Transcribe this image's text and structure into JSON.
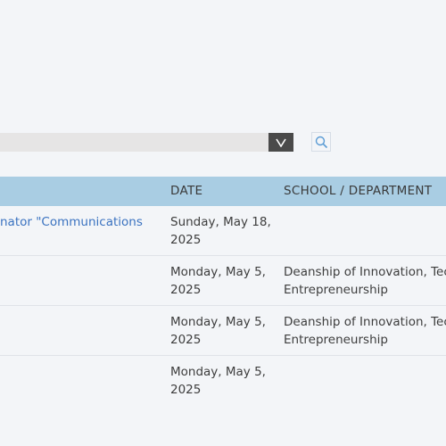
{
  "filter": {
    "select_value": "",
    "dropdown_glyph": "V",
    "search_icon": "search-icon"
  },
  "table": {
    "headers": {
      "date": "DATE",
      "school": "SCHOOL / DEPARTMENT"
    },
    "rows": [
      {
        "title": "nator \"Communications",
        "date_line1": "Sunday, May 18,",
        "date_line2": "2025",
        "school_line1": "",
        "school_line2": ""
      },
      {
        "title": "",
        "date_line1": "Monday, May 5,",
        "date_line2": "2025",
        "school_line1": "Deanship of Innovation, Tec",
        "school_line2": "Entrepreneurship"
      },
      {
        "title": "",
        "date_line1": "Monday, May 5,",
        "date_line2": "2025",
        "school_line1": "Deanship of Innovation, Tec",
        "school_line2": "Entrepreneurship"
      },
      {
        "title": "",
        "date_line1": "Monday, May 5,",
        "date_line2": "2025",
        "school_line1": "",
        "school_line2": ""
      }
    ]
  },
  "colors": {
    "header_bg": "#a9cde3",
    "link": "#3a72c0",
    "select_bg": "#e6e5e5",
    "dropdown_bg": "#4a4a4a",
    "page_bg": "#f3f5f8"
  }
}
